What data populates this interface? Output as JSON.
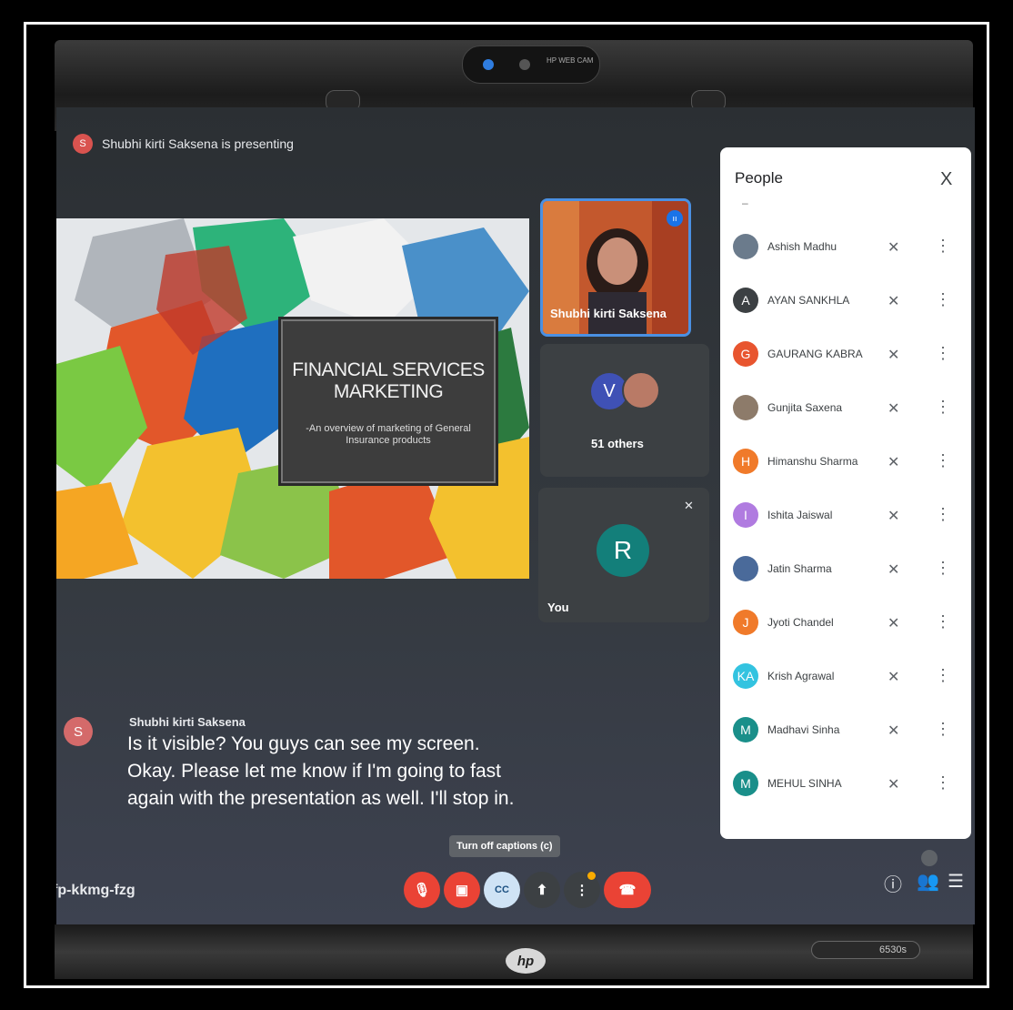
{
  "meeting": {
    "presenting_avatar": "S",
    "presenting_text": "Shubhi kirti Saksena is presenting",
    "meeting_code": "fp-kkmg-fzg"
  },
  "slide": {
    "title": "FINANCIAL SERVICES MARKETING",
    "subtitle": "-An overview of marketing of General Insurance products"
  },
  "tiles": {
    "presenter_name": "Shubhi kirti Saksena",
    "others_avatar": "V",
    "others_label": "51 others",
    "self_avatar": "R",
    "self_label": "You"
  },
  "captions": {
    "avatar": "S",
    "speaker": "Shubhi kirti Saksena",
    "lines": [
      "Is it visible? You guys can see my screen.",
      "Okay. Please let me know if I'm going to fast",
      "again with the presentation as well. I'll stop in."
    ]
  },
  "controls": {
    "tooltip": "Turn off captions (c)",
    "captions_label": "CC"
  },
  "people_panel": {
    "title": "People",
    "close": "X",
    "dash": "–",
    "participants": [
      {
        "initial": "",
        "name": "Ashish Madhu",
        "color": "#6b7b8c"
      },
      {
        "initial": "A",
        "name": "AYAN SANKHLA",
        "color": "#3c4043"
      },
      {
        "initial": "G",
        "name": "GAURANG KABRA",
        "color": "#e8552f"
      },
      {
        "initial": "",
        "name": "Gunjita Saxena",
        "color": "#8d7b6a"
      },
      {
        "initial": "H",
        "name": "Himanshu Sharma",
        "color": "#f07a2a"
      },
      {
        "initial": "I",
        "name": "Ishita Jaiswal",
        "color": "#b07be0"
      },
      {
        "initial": "",
        "name": "Jatin Sharma",
        "color": "#4a6a9a"
      },
      {
        "initial": "J",
        "name": "Jyoti Chandel",
        "color": "#f07a2a"
      },
      {
        "initial": "KA",
        "name": "Krish Agrawal",
        "color": "#33c3e0"
      },
      {
        "initial": "M",
        "name": "Madhavi Sinha",
        "color": "#1a8f8a"
      },
      {
        "initial": "M",
        "name": "MEHUL SINHA",
        "color": "#1a8f8a"
      }
    ]
  },
  "hardware": {
    "webcam_label": "HP WEB CAM",
    "hp_logo": "hp",
    "model": "6530s"
  }
}
